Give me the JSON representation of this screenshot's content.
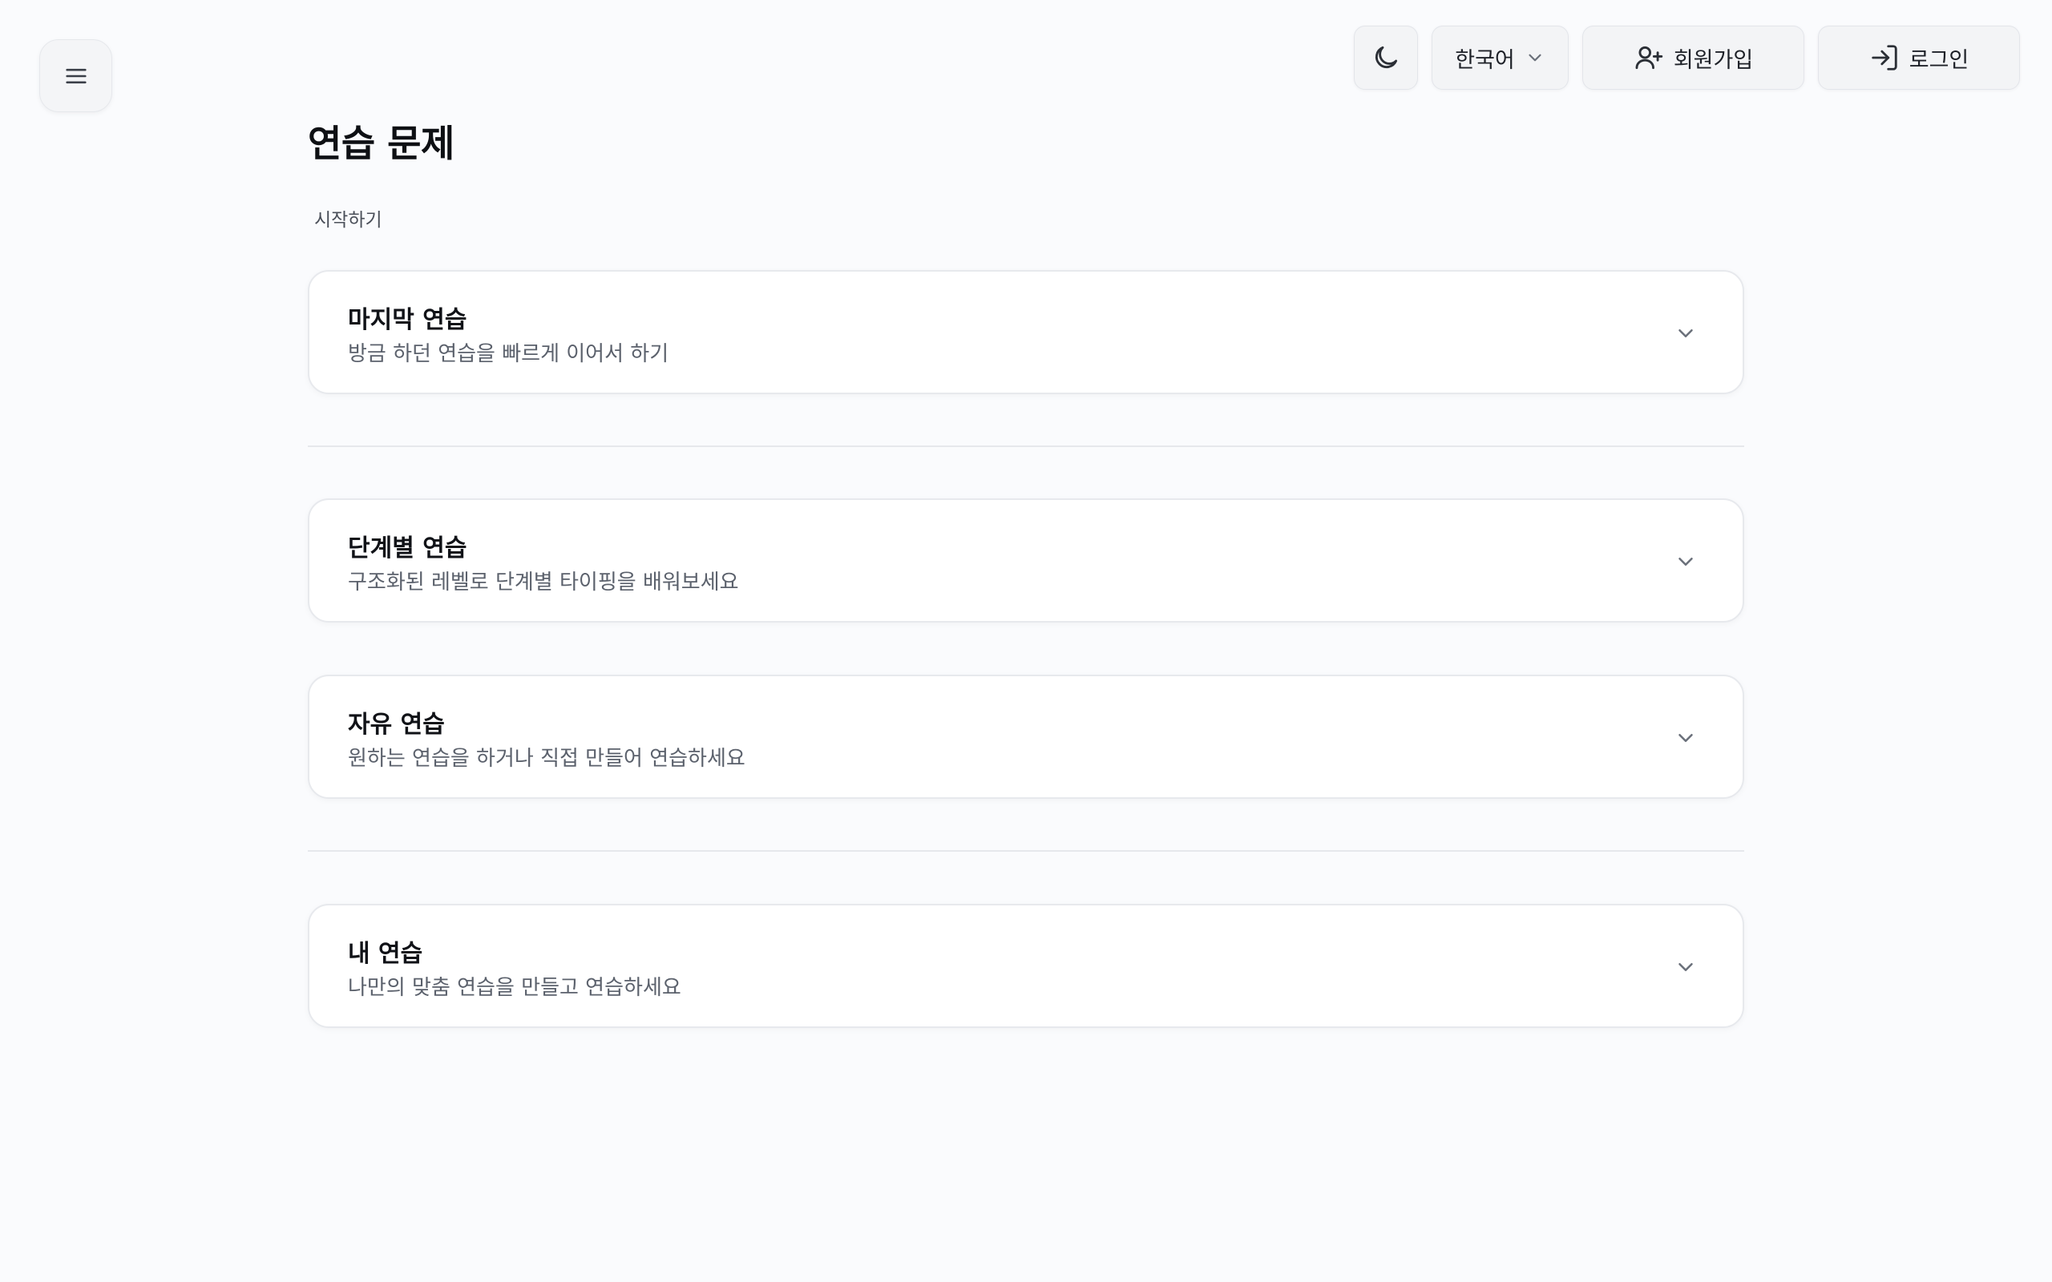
{
  "header": {
    "menu_icon": "hamburger-menu-icon",
    "theme_icon": "moon-icon",
    "language_label": "한국어",
    "signup_label": "회원가입",
    "login_label": "로그인"
  },
  "page": {
    "title": "연습 문제",
    "section_label": "시작하기"
  },
  "cards": [
    {
      "title": "마지막 연습",
      "description": "방금 하던 연습을 빠르게 이어서 하기"
    },
    {
      "title": "단계별 연습",
      "description": "구조화된 레벨로 단계별 타이핑을 배워보세요"
    },
    {
      "title": "자유 연습",
      "description": "원하는 연습을 하거나 직접 만들어 연습하세요"
    },
    {
      "title": "내 연습",
      "description": "나만의 맞춤 연습을 만들고 연습하세요"
    }
  ],
  "colors": {
    "background": "#fafbfd",
    "card_border": "#e7e9ed",
    "text_primary": "#101217",
    "text_secondary": "#5b616c"
  }
}
